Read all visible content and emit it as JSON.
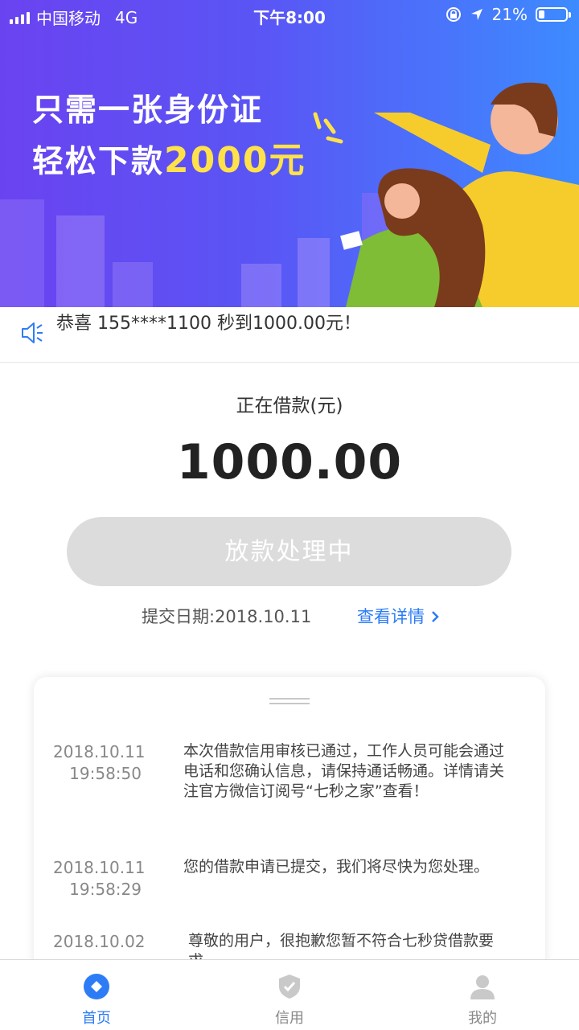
{
  "status_bar": {
    "carrier": "中国移动",
    "network": "4G",
    "time": "下午8:00",
    "battery_percent": "21%",
    "battery_level": 0.21
  },
  "banner": {
    "line1": "只需一张身份证",
    "line2_prefix": "轻松下款",
    "line2_amount": "2000元"
  },
  "notice": {
    "text": "恭喜 155****1100 秒到1000.00元！"
  },
  "loan": {
    "label": "正在借款(元)",
    "amount": "1000.00",
    "status_button": "放款处理中",
    "submit_date": "提交日期:2018.10.11",
    "details_link": "查看详情"
  },
  "timeline": [
    {
      "date": "2018.10.11",
      "time": "19:58:50",
      "message": "本次借款信用审核已通过，工作人员可能会通过电话和您确认信息，请保持通话畅通。详情请关注官方微信订阅号“七秒之家”查看！"
    },
    {
      "date": "2018.10.11",
      "time": "19:58:29",
      "message": "您的借款申请已提交，我们将尽快为您处理。"
    },
    {
      "date": "2018.10.02",
      "time": "",
      "message": "尊敬的用户，很抱歉您暂不符合七秒贷借款要求。"
    }
  ],
  "tabs": [
    {
      "label": "首页",
      "icon": "home-icon",
      "active": true
    },
    {
      "label": "信用",
      "icon": "shield-check-icon",
      "active": false
    },
    {
      "label": "我的",
      "icon": "user-icon",
      "active": false
    }
  ],
  "colors": {
    "accent": "#2d7cf6",
    "banner_start": "#6a43f0",
    "banner_end": "#3d8bff",
    "highlight_yellow": "#ffe24a",
    "button_disabled": "#dcdcdc"
  }
}
